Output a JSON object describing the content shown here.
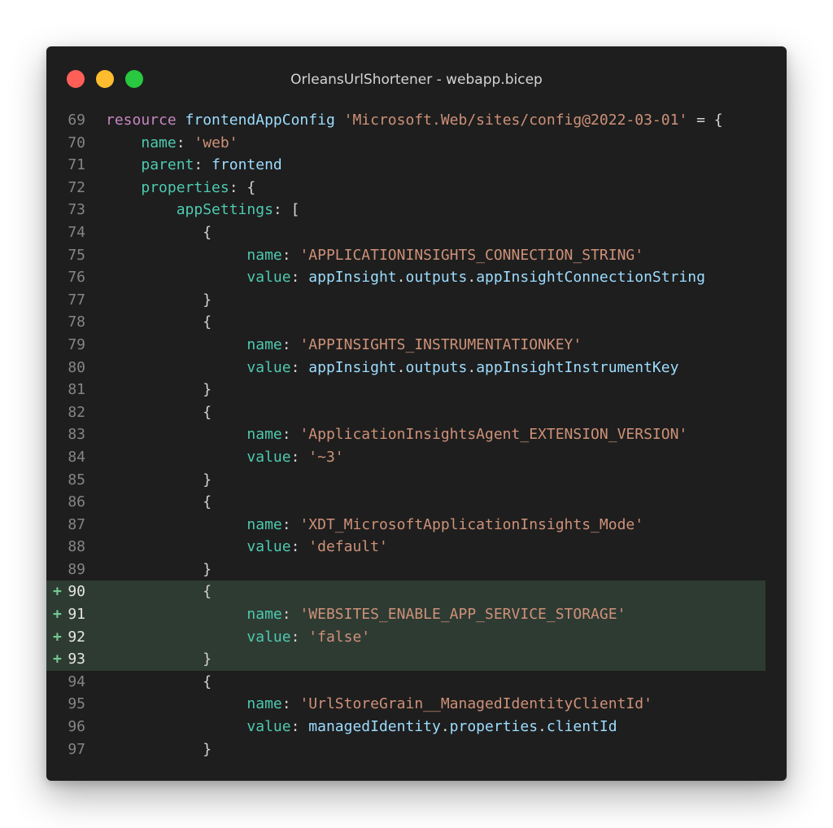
{
  "window": {
    "title": "OrleansUrlShortener - webapp.bicep",
    "controls": [
      "close-button",
      "minimize-button",
      "zoom-button"
    ]
  },
  "editor": {
    "file_name": "webapp.bicep",
    "project_name": "OrleansUrlShortener",
    "diff_marker": "+",
    "lines": [
      {
        "number": "69",
        "added": false,
        "indent": "",
        "tokens": [
          {
            "text": "resource",
            "type": "kw"
          },
          {
            "text": " ",
            "type": "punct"
          },
          {
            "text": "frontendAppConfig",
            "type": "var"
          },
          {
            "text": " ",
            "type": "punct"
          },
          {
            "text": "'Microsoft.Web/sites/config@2022-03-01'",
            "type": "str"
          },
          {
            "text": " = {",
            "type": "punct"
          }
        ]
      },
      {
        "number": "70",
        "added": false,
        "indent": "    ",
        "tokens": [
          {
            "text": "name",
            "type": "prop"
          },
          {
            "text": ": ",
            "type": "punct"
          },
          {
            "text": "'web'",
            "type": "str"
          }
        ]
      },
      {
        "number": "71",
        "added": false,
        "indent": "    ",
        "tokens": [
          {
            "text": "parent",
            "type": "prop"
          },
          {
            "text": ": ",
            "type": "punct"
          },
          {
            "text": "frontend",
            "type": "var"
          }
        ]
      },
      {
        "number": "72",
        "added": false,
        "indent": "    ",
        "tokens": [
          {
            "text": "properties",
            "type": "prop"
          },
          {
            "text": ": {",
            "type": "punct"
          }
        ]
      },
      {
        "number": "73",
        "added": false,
        "indent": "        ",
        "tokens": [
          {
            "text": "appSettings",
            "type": "prop"
          },
          {
            "text": ": [",
            "type": "punct"
          }
        ]
      },
      {
        "number": "74",
        "added": false,
        "indent": "           ",
        "tokens": [
          {
            "text": "{",
            "type": "punct"
          }
        ]
      },
      {
        "number": "75",
        "added": false,
        "indent": "                ",
        "tokens": [
          {
            "text": "name",
            "type": "prop"
          },
          {
            "text": ": ",
            "type": "punct"
          },
          {
            "text": "'APPLICATIONINSIGHTS_CONNECTION_STRING'",
            "type": "str"
          }
        ]
      },
      {
        "number": "76",
        "added": false,
        "indent": "                ",
        "tokens": [
          {
            "text": "value",
            "type": "prop"
          },
          {
            "text": ": ",
            "type": "punct"
          },
          {
            "text": "appInsight",
            "type": "var"
          },
          {
            "text": ".",
            "type": "punct"
          },
          {
            "text": "outputs",
            "type": "var"
          },
          {
            "text": ".",
            "type": "punct"
          },
          {
            "text": "appInsightConnectionString",
            "type": "var"
          }
        ]
      },
      {
        "number": "77",
        "added": false,
        "indent": "           ",
        "tokens": [
          {
            "text": "}",
            "type": "punct"
          }
        ]
      },
      {
        "number": "78",
        "added": false,
        "indent": "           ",
        "tokens": [
          {
            "text": "{",
            "type": "punct"
          }
        ]
      },
      {
        "number": "79",
        "added": false,
        "indent": "                ",
        "tokens": [
          {
            "text": "name",
            "type": "prop"
          },
          {
            "text": ": ",
            "type": "punct"
          },
          {
            "text": "'APPINSIGHTS_INSTRUMENTATIONKEY'",
            "type": "str"
          }
        ]
      },
      {
        "number": "80",
        "added": false,
        "indent": "                ",
        "tokens": [
          {
            "text": "value",
            "type": "prop"
          },
          {
            "text": ": ",
            "type": "punct"
          },
          {
            "text": "appInsight",
            "type": "var"
          },
          {
            "text": ".",
            "type": "punct"
          },
          {
            "text": "outputs",
            "type": "var"
          },
          {
            "text": ".",
            "type": "punct"
          },
          {
            "text": "appInsightInstrumentKey",
            "type": "var"
          }
        ]
      },
      {
        "number": "81",
        "added": false,
        "indent": "           ",
        "tokens": [
          {
            "text": "}",
            "type": "punct"
          }
        ]
      },
      {
        "number": "82",
        "added": false,
        "indent": "           ",
        "tokens": [
          {
            "text": "{",
            "type": "punct"
          }
        ]
      },
      {
        "number": "83",
        "added": false,
        "indent": "                ",
        "tokens": [
          {
            "text": "name",
            "type": "prop"
          },
          {
            "text": ": ",
            "type": "punct"
          },
          {
            "text": "'ApplicationInsightsAgent_EXTENSION_VERSION'",
            "type": "str"
          }
        ]
      },
      {
        "number": "84",
        "added": false,
        "indent": "                ",
        "tokens": [
          {
            "text": "value",
            "type": "prop"
          },
          {
            "text": ": ",
            "type": "punct"
          },
          {
            "text": "'~3'",
            "type": "str"
          }
        ]
      },
      {
        "number": "85",
        "added": false,
        "indent": "           ",
        "tokens": [
          {
            "text": "}",
            "type": "punct"
          }
        ]
      },
      {
        "number": "86",
        "added": false,
        "indent": "           ",
        "tokens": [
          {
            "text": "{",
            "type": "punct"
          }
        ]
      },
      {
        "number": "87",
        "added": false,
        "indent": "                ",
        "tokens": [
          {
            "text": "name",
            "type": "prop"
          },
          {
            "text": ": ",
            "type": "punct"
          },
          {
            "text": "'XDT_MicrosoftApplicationInsights_Mode'",
            "type": "str"
          }
        ]
      },
      {
        "number": "88",
        "added": false,
        "indent": "                ",
        "tokens": [
          {
            "text": "value",
            "type": "prop"
          },
          {
            "text": ": ",
            "type": "punct"
          },
          {
            "text": "'default'",
            "type": "str"
          }
        ]
      },
      {
        "number": "89",
        "added": false,
        "indent": "           ",
        "tokens": [
          {
            "text": "}",
            "type": "punct"
          }
        ]
      },
      {
        "number": "90",
        "added": true,
        "indent": "           ",
        "tokens": [
          {
            "text": "{",
            "type": "punct"
          }
        ]
      },
      {
        "number": "91",
        "added": true,
        "indent": "                ",
        "tokens": [
          {
            "text": "name",
            "type": "prop"
          },
          {
            "text": ": ",
            "type": "punct"
          },
          {
            "text": "'WEBSITES_ENABLE_APP_SERVICE_STORAGE'",
            "type": "str"
          }
        ]
      },
      {
        "number": "92",
        "added": true,
        "indent": "                ",
        "tokens": [
          {
            "text": "value",
            "type": "prop"
          },
          {
            "text": ": ",
            "type": "punct"
          },
          {
            "text": "'false'",
            "type": "str"
          }
        ]
      },
      {
        "number": "93",
        "added": true,
        "indent": "           ",
        "tokens": [
          {
            "text": "}",
            "type": "punct"
          }
        ]
      },
      {
        "number": "94",
        "added": false,
        "indent": "           ",
        "tokens": [
          {
            "text": "{",
            "type": "punct"
          }
        ]
      },
      {
        "number": "95",
        "added": false,
        "indent": "                ",
        "tokens": [
          {
            "text": "name",
            "type": "prop"
          },
          {
            "text": ": ",
            "type": "punct"
          },
          {
            "text": "'UrlStoreGrain__ManagedIdentityClientId'",
            "type": "str"
          }
        ]
      },
      {
        "number": "96",
        "added": false,
        "indent": "                ",
        "tokens": [
          {
            "text": "value",
            "type": "prop"
          },
          {
            "text": ": ",
            "type": "punct"
          },
          {
            "text": "managedIdentity",
            "type": "var"
          },
          {
            "text": ".",
            "type": "punct"
          },
          {
            "text": "properties",
            "type": "var"
          },
          {
            "text": ".",
            "type": "punct"
          },
          {
            "text": "clientId",
            "type": "var"
          }
        ]
      },
      {
        "number": "97",
        "added": false,
        "indent": "           ",
        "tokens": [
          {
            "text": "}",
            "type": "punct"
          }
        ]
      }
    ]
  },
  "colors": {
    "background": "#1e1e1e",
    "added_line_bg": "#2e3b33",
    "keyword": "#c586c0",
    "identifier": "#9cdcfe",
    "property": "#4ec9b0",
    "string": "#ce9178",
    "line_number": "#858585",
    "diff_marker": "#73c991"
  }
}
